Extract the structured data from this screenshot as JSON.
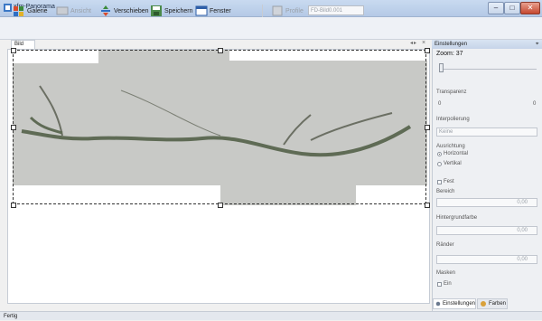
{
  "window": {
    "title": "xfm-Panorama"
  },
  "toolbar": {
    "gallery": "Galerie",
    "view": "Ansicht",
    "move": "Verschieben",
    "save": "Speichern",
    "window": "Fenster",
    "profile": "Profile",
    "profile_value": "FD-Bild0.001"
  },
  "document": {
    "tab": "Bild"
  },
  "panel": {
    "title": "Einstellungen",
    "zoom_label": "Zoom: 37",
    "zoom_value": 37,
    "labels": [
      "Transparenz",
      "Interpolierung",
      "Ausrichtung",
      "Bereich",
      "Hintergrundfarbe",
      "Ränder",
      "Masken"
    ],
    "interp_value": "Keine",
    "radio1": "Horizontal",
    "radio2": "Vertikal",
    "check_label": "Fest",
    "field1_value": "0,00",
    "field2_value": "0,00",
    "field3_value": "0,00",
    "check2_label": "Ein",
    "tab1": "Einstellungen",
    "tab2": "Farben"
  },
  "status": {
    "text": "Fertig"
  },
  "colors": {
    "accent": "#2f5fa8",
    "titlebar": "#c3d5ee"
  }
}
